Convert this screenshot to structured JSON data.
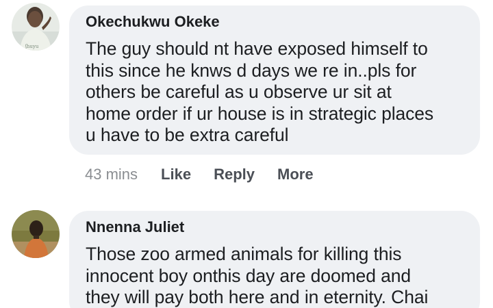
{
  "comments": [
    {
      "author": "Okechukwu Okeke",
      "text": "The guy should nt have exposed himself to\nthis since he knws d days we re in..pls for\nothers be careful as u observe ur sit at\nhome order if ur house is in strategic places\nu have to be extra careful",
      "time": "43 mins",
      "actions": {
        "like": "Like",
        "reply": "Reply",
        "more": "More"
      }
    },
    {
      "author": "Nnenna Juliet",
      "text": "Those zoo armed animals for killing this\ninnocent boy onthis day are doomed and\nthey will pay both here and in eternity. Chai"
    }
  ],
  "colors": {
    "bubble": "#eff1f4",
    "text": "#1c1e21",
    "meta": "#8a8d91",
    "action": "#4b4f56"
  }
}
